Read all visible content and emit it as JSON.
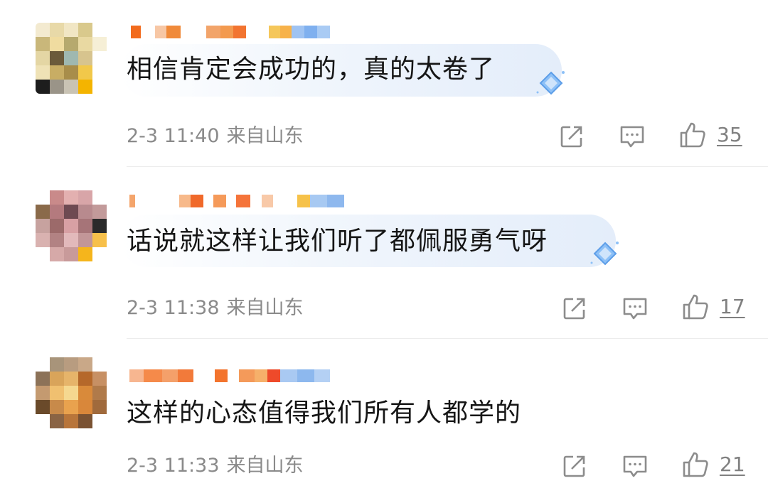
{
  "comments": [
    {
      "text": "相信肯定会成功的，真的太卷了",
      "time": "2-3 11:40",
      "location": "来自山东",
      "likes": "35",
      "has_badge": true
    },
    {
      "text": "话说就这样让我们听了都佩服勇气呀",
      "time": "2-3 11:38",
      "location": "来自山东",
      "likes": "17",
      "has_badge": true
    },
    {
      "text": "这样的心态值得我们所有人都学的",
      "time": "2-3 11:33",
      "location": "来自山东",
      "likes": "21",
      "has_badge": false
    }
  ],
  "icons": {
    "repost": "repost-icon",
    "reply": "comment-icon",
    "like": "thumbs-up-icon"
  },
  "colors": {
    "meta_text": "#8a8a8a",
    "icon_gray": "#8c8c8c",
    "badge_blue": "#6aa9f0"
  }
}
